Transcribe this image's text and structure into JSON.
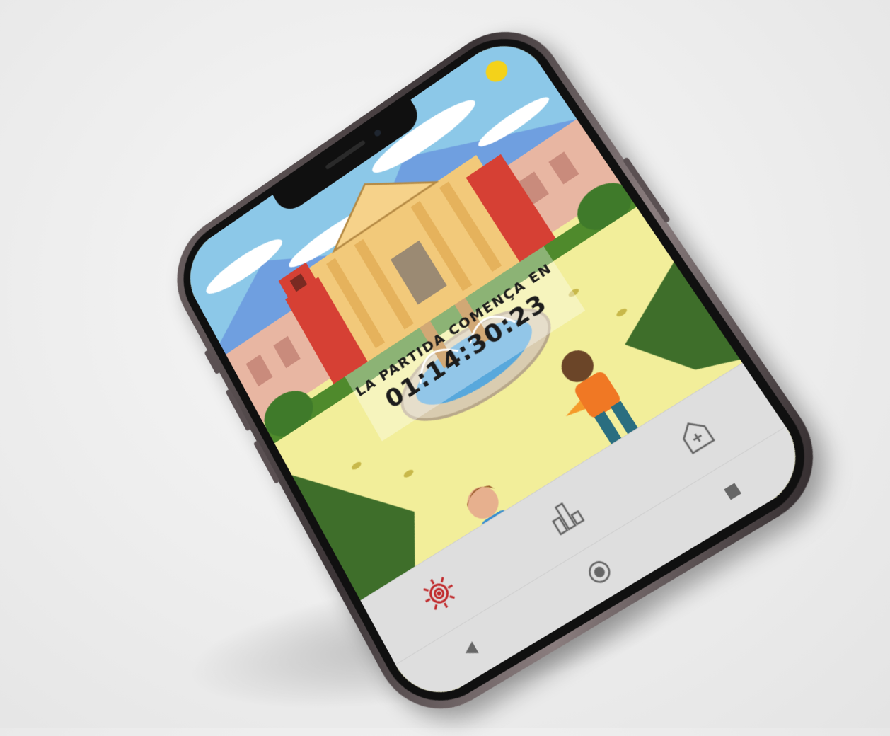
{
  "countdown": {
    "label": "LA PARTIDA COMENÇA EN",
    "value": "01:14:30:23"
  },
  "tabs": [
    {
      "icon": "target-icon",
      "active": true
    },
    {
      "icon": "ranking-icon",
      "active": false
    },
    {
      "icon": "home-icon",
      "active": false
    }
  ],
  "system_nav": [
    {
      "icon": "back-icon"
    },
    {
      "icon": "home-circle-icon"
    },
    {
      "icon": "recents-icon"
    }
  ],
  "colors": {
    "accent": "#c0282a",
    "sky": "#8cc8e8",
    "ground": "#f2ee9a",
    "nav_bg": "#dedede"
  }
}
